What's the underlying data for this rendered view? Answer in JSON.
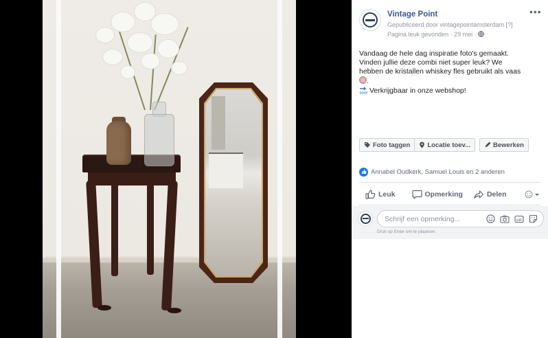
{
  "post": {
    "page_name": "Vintage Point",
    "published_by": "Gepubliceerd door vintagepointamsterdam",
    "published_help": "[?]",
    "liked_line": "Pagina leuk gevonden · 29 mei ·",
    "more_label": "•••",
    "body_lines": [
      "Vandaag de hele dag inspiratie foto's gemaakt.",
      "Vinden jullie deze combi niet super leuk? We",
      "hebben de kristallen whiskey fles gebruikt als vaas",
      "Verkrijgbaar in onze webshop!"
    ]
  },
  "tag_buttons": {
    "tag_photo": "Foto taggen",
    "add_location": "Locatie toev...",
    "edit": "Bewerken"
  },
  "reactions": {
    "names": "Annabel Oudkerk, Samuel Louis en 2 anderen"
  },
  "actions": {
    "like": "Leuk",
    "comment": "Opmerking",
    "share": "Delen"
  },
  "comment_box": {
    "placeholder": "Schrijf een opmerking...",
    "hint": "Druk op Enter om te plaatsen."
  },
  "colors": {
    "link": "#385898",
    "accent": "#1877f2",
    "muted": "#90949c"
  },
  "icons": [
    "globe-icon",
    "tag-icon",
    "location-pin-icon",
    "pencil-icon",
    "like-thumb-icon",
    "comment-bubble-icon",
    "share-arrow-icon",
    "emoji-reaction-icon",
    "camera-icon",
    "gif-icon",
    "sticker-icon"
  ]
}
